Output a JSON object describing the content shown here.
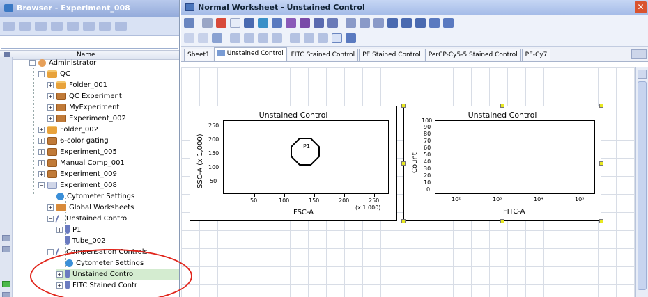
{
  "browser": {
    "title": "Browser - Experiment_008",
    "column_header": "Name",
    "tree": [
      {
        "label": "Administrator",
        "icon": "user-icon"
      },
      {
        "label": "QC",
        "icon": "folder-icon"
      },
      {
        "label": "Folder_001",
        "icon": "folder-icon"
      },
      {
        "label": "QC Experiment",
        "icon": "experiment-icon"
      },
      {
        "label": "MyExperiment",
        "icon": "experiment-icon"
      },
      {
        "label": "Experiment_002",
        "icon": "experiment-icon"
      },
      {
        "label": "Folder_002",
        "icon": "folder-icon"
      },
      {
        "label": "6-color gating",
        "icon": "experiment-icon"
      },
      {
        "label": "Experiment_005",
        "icon": "experiment-icon"
      },
      {
        "label": "Manual Comp_001",
        "icon": "experiment-icon"
      },
      {
        "label": "Experiment_009",
        "icon": "experiment-icon"
      },
      {
        "label": "Experiment_008",
        "icon": "experiment-open-icon"
      },
      {
        "label": "Cytometer Settings",
        "icon": "cytometer-icon"
      },
      {
        "label": "Global Worksheets",
        "icon": "worksheet-icon"
      },
      {
        "label": "Unstained Control",
        "icon": "specimen-icon"
      },
      {
        "label": "P1",
        "icon": "tube-icon"
      },
      {
        "label": "Tube_002",
        "icon": "tube-icon"
      },
      {
        "label": "Compensation Controls",
        "icon": "specimen-icon"
      },
      {
        "label": "Cytometer Settings",
        "icon": "cytometer-icon"
      },
      {
        "label": "Unstained Control",
        "icon": "tube-icon"
      },
      {
        "label": "FITC Stained Contr",
        "icon": "tube-icon"
      }
    ]
  },
  "worksheet": {
    "title": "Normal Worksheet - Unstained Control",
    "close_label": "✕",
    "tabs": [
      "Sheet1",
      "Unstained Control",
      "FITC Stained Control",
      "PE Stained Control",
      "PerCP-Cy5-5 Stained Control",
      "PE-Cy7"
    ],
    "active_tab": "Unstained Control"
  },
  "plots": {
    "dot": {
      "title": "Unstained Control",
      "xlabel": "FSC-A",
      "ylabel": "SSC-A (x 1,000)",
      "x_ticks": [
        "50",
        "100",
        "150",
        "200",
        "250"
      ],
      "x_multiplier": "(x 1,000)",
      "y_ticks": [
        "50",
        "100",
        "150",
        "200",
        "250"
      ],
      "gate": "P1"
    },
    "histogram": {
      "title": "Unstained Control",
      "xlabel": "FITC-A",
      "ylabel": "Count",
      "x_ticks": [
        "10²",
        "10³",
        "10⁴",
        "10⁵"
      ],
      "y_ticks": [
        "0",
        "10",
        "20",
        "30",
        "40",
        "50",
        "60",
        "70",
        "80",
        "90",
        "100"
      ]
    }
  },
  "colors": {
    "annotation": "#e1251b",
    "selected_row": "#d4ecd0",
    "handle": "#e8e820"
  }
}
